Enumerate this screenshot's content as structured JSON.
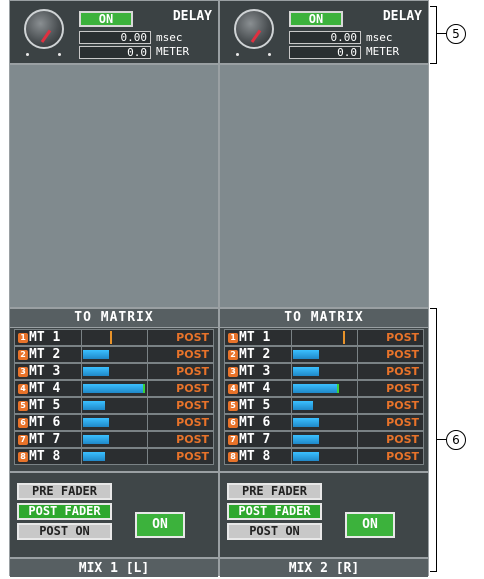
{
  "panels": [
    {
      "delay": {
        "on_label": "ON",
        "title": "DELAY",
        "msec_value": "0.00",
        "msec_unit": "msec",
        "meter_value": "0.0",
        "meter_unit": "METER"
      },
      "matrix_title": "TO MATRIX",
      "rows": [
        {
          "num": "1",
          "label": "MT 1",
          "send": "POST",
          "level": 0.0
        },
        {
          "num": "2",
          "label": "MT 2",
          "send": "POST",
          "level": 0.45
        },
        {
          "num": "3",
          "label": "MT 3",
          "send": "POST",
          "level": 0.45
        },
        {
          "num": "4",
          "label": "MT 4",
          "send": "POST",
          "level": 1.0
        },
        {
          "num": "5",
          "label": "MT 5",
          "send": "POST",
          "level": 0.45
        },
        {
          "num": "6",
          "label": "MT 6",
          "send": "POST",
          "level": 0.45
        },
        {
          "num": "7",
          "label": "MT 7",
          "send": "POST",
          "level": 0.45
        },
        {
          "num": "8",
          "label": "MT 8",
          "send": "POST",
          "level": 0.45
        }
      ],
      "buttons": {
        "pre_fader": "PRE FADER",
        "post_fader": "POST FADER",
        "post_on": "POST ON",
        "on": "ON"
      },
      "footer": "MIX 1 [L]"
    },
    {
      "delay": {
        "on_label": "ON",
        "title": "DELAY",
        "msec_value": "0.00",
        "msec_unit": "msec",
        "meter_value": "0.0",
        "meter_unit": "METER"
      },
      "matrix_title": "TO MATRIX",
      "rows": [
        {
          "num": "1",
          "label": "MT 1",
          "send": "POST",
          "level": 0.0
        },
        {
          "num": "2",
          "label": "MT 2",
          "send": "POST",
          "level": 0.45
        },
        {
          "num": "3",
          "label": "MT 3",
          "send": "POST",
          "level": 0.45
        },
        {
          "num": "4",
          "label": "MT 4",
          "send": "POST",
          "level": 1.0
        },
        {
          "num": "5",
          "label": "MT 5",
          "send": "POST",
          "level": 0.45
        },
        {
          "num": "6",
          "label": "MT 6",
          "send": "POST",
          "level": 0.45
        },
        {
          "num": "7",
          "label": "MT 7",
          "send": "POST",
          "level": 0.45
        },
        {
          "num": "8",
          "label": "MT 8",
          "send": "POST",
          "level": 0.45
        }
      ],
      "buttons": {
        "pre_fader": "PRE FADER",
        "post_fader": "POST FADER",
        "post_on": "POST ON",
        "on": "ON"
      },
      "footer": "MIX 2 [R]"
    }
  ],
  "callouts": {
    "c5": "5",
    "c6": "6"
  }
}
